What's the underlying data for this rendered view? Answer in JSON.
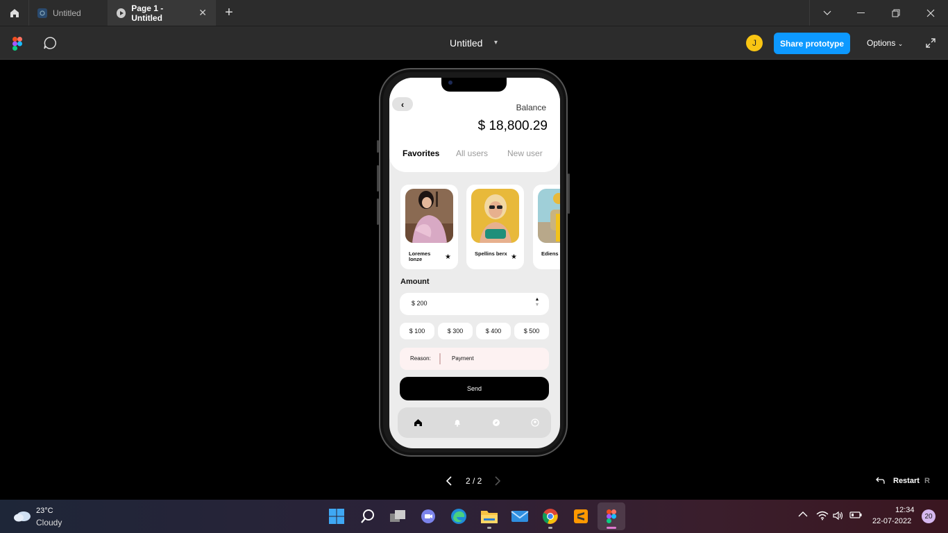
{
  "window": {
    "tabs": [
      {
        "label": "Untitled",
        "icon": "figma-file-icon"
      },
      {
        "label": "Page 1 - Untitled",
        "icon": "play-icon",
        "close": "✕"
      }
    ],
    "new_tab": "+"
  },
  "toolbar": {
    "doc_title": "Untitled",
    "avatar_initial": "J",
    "avatar_color": "#f9c513",
    "share_label": "Share prototype",
    "share_color": "#0d99ff",
    "options_label": "Options"
  },
  "app": {
    "balance_label": "Balance",
    "balance_amount": "$ 18,800.29",
    "tabs": [
      "Favorites",
      "All users",
      "New user"
    ],
    "favorites": [
      {
        "name": "Loremes lonze"
      },
      {
        "name": "Spellins berx"
      },
      {
        "name": "Ediens letn"
      }
    ],
    "amount_label": "Amount",
    "amount_value": "$ 200",
    "amount_chips": [
      "$ 100",
      "$ 300",
      "$ 400",
      "$ 500"
    ],
    "reason_label": "Reason:",
    "reason_value": "Payment",
    "send_label": "Send",
    "nav": [
      "home-icon",
      "bell-icon",
      "compass-icon",
      "user-icon"
    ]
  },
  "pager": {
    "text": "2 / 2",
    "restart_label": "Restart",
    "restart_key": "R"
  },
  "taskbar": {
    "temperature": "23°C",
    "weather": "Cloudy",
    "time": "12:34",
    "date": "22-07-2022",
    "notifications": "20"
  }
}
